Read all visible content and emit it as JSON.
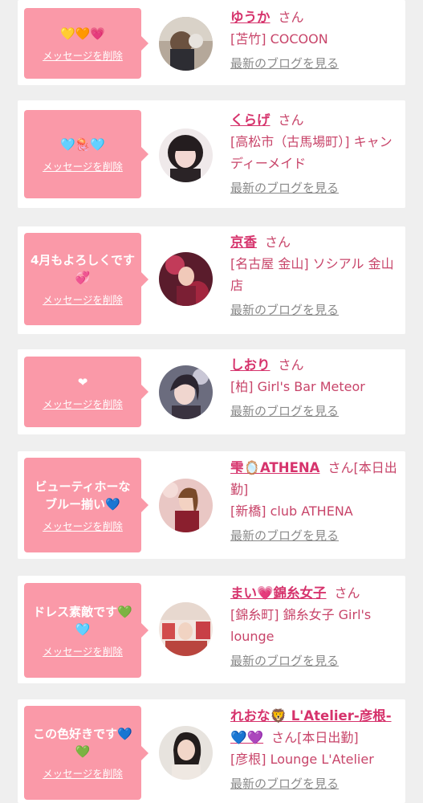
{
  "colors": {
    "background": "#efefef",
    "card": "#ffffff",
    "bubble": "#fa99a8",
    "name": "#d6336c",
    "text": "#c8456a",
    "link_gray": "#8a8a8a"
  },
  "delete_label": "メッセージを削除",
  "san_label": "さん",
  "blog_label": "最新のブログを見る",
  "entries": [
    {
      "message": "💛🧡💗",
      "name": "ゆうか",
      "shop": "[苫竹] COCOON"
    },
    {
      "message": "🩵🪼🩵",
      "name": "くらげ",
      "shop": "[高松市（古馬場町）] キャンディーメイド"
    },
    {
      "message": "4月もよろしくです💞",
      "name": "京香",
      "shop": "[名古屋 金山] ソシアル 金山店"
    },
    {
      "message": "❤︎",
      "name": "しおり",
      "shop": "[柏] Girl's Bar Meteor"
    },
    {
      "message": "ビューティホーなブルー揃い💙",
      "name": "雫🪞ATHENA",
      "extra": "[本日出勤]",
      "shop": "[新橋] club ATHENA"
    },
    {
      "message": "ドレス素敵です💚🩵",
      "name": "まい💗錦糸女子",
      "shop": "[錦糸町] 錦糸女子 Girl's lounge"
    },
    {
      "message": "この色好きです💙💚",
      "name": "れおな🦁 L'Atelier-彦根-💙💜",
      "extra": "[本日出勤]",
      "shop": "[彦根] Lounge L'Atelier"
    }
  ]
}
